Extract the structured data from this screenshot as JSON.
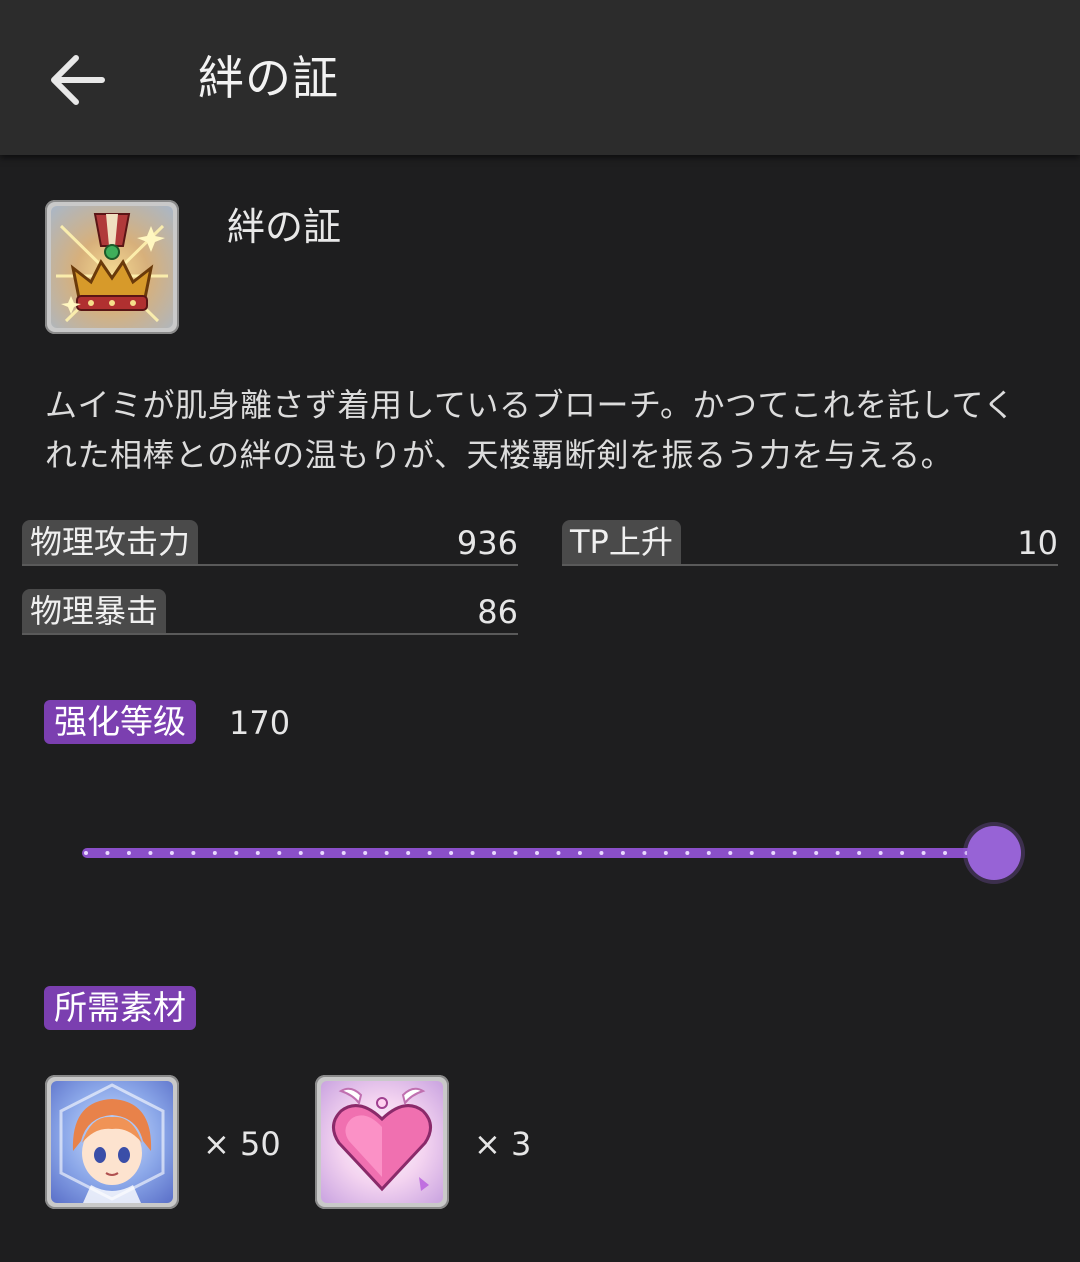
{
  "appbar": {
    "title": "絆の証"
  },
  "item": {
    "name": "絆の証",
    "icon": "crown-medal-icon",
    "description_lines": [
      "ムイミが肌身離さず着用しているブローチ。かつてこれを託してく",
      "れた相棒との絆の温もりが、天楼覇断剣を振るう力を与える。"
    ]
  },
  "stats": [
    {
      "label": "物理攻击力",
      "value": "936"
    },
    {
      "label": "TP上升",
      "value": "10"
    },
    {
      "label": "物理暴击",
      "value": "86"
    }
  ],
  "enhance": {
    "label": "强化等级",
    "value": "170",
    "slider_fraction": 1.0
  },
  "materials": {
    "label": "所需素材",
    "items": [
      {
        "icon": "character-memory-piece-icon",
        "count": "× 50"
      },
      {
        "icon": "heart-fragment-icon",
        "count": "× 3"
      }
    ]
  },
  "colors": {
    "accent": "#7b3fb0",
    "slider": "#9763d6",
    "background": "#1e1e1f",
    "appbar": "#2c2c2c"
  }
}
